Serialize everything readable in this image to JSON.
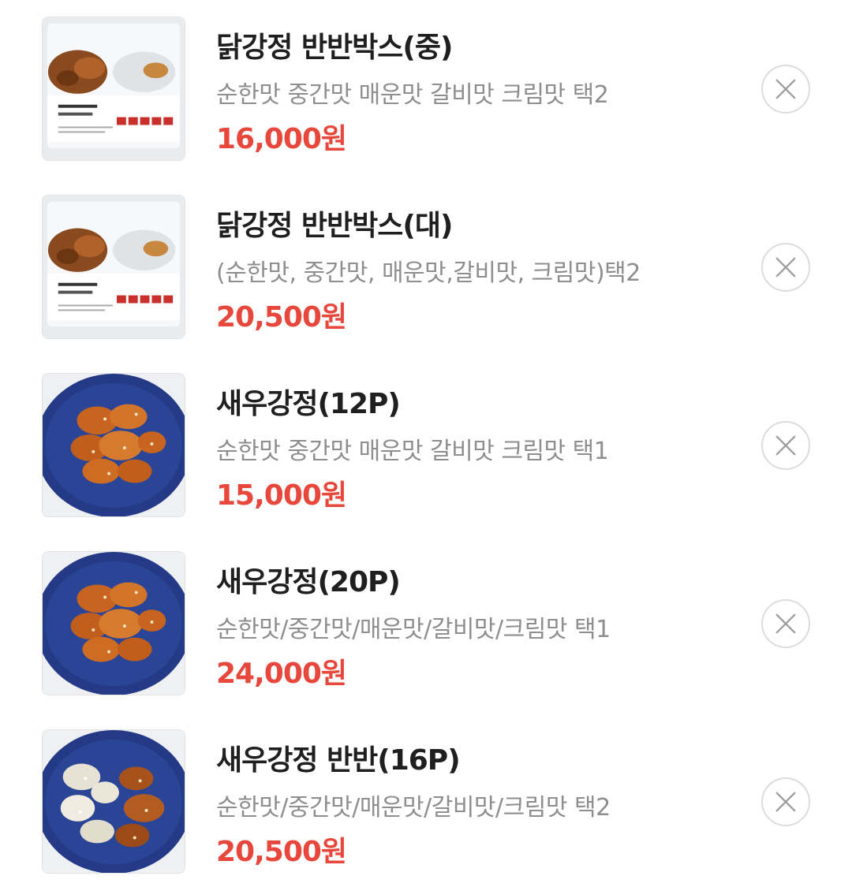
{
  "cart": {
    "items": [
      {
        "title": "닭강정 반반박스(중)",
        "options": "순한맛 중간맛 매운맛 갈비맛 크림맛 택2",
        "price": "16,000원",
        "image": "boxed-chicken-photo",
        "remove_icon": "close-icon"
      },
      {
        "title": "닭강정 반반박스(대)",
        "options": "(순한맛, 중간맛, 매운맛,갈비맛, 크림맛)택2",
        "price": "20,500원",
        "image": "boxed-chicken-photo",
        "remove_icon": "close-icon"
      },
      {
        "title": "새우강정(12P)",
        "options": "순한맛 중간맛 매운맛 갈비맛 크림맛 택1",
        "price": "15,000원",
        "image": "shrimp-plate-photo",
        "remove_icon": "close-icon"
      },
      {
        "title": "새우강정(20P)",
        "options": "순한맛/중간맛/매운맛/갈비맛/크림맛 택1",
        "price": "24,000원",
        "image": "shrimp-plate-photo",
        "remove_icon": "close-icon"
      },
      {
        "title": "새우강정 반반(16P)",
        "options": "순한맛/중간맛/매운맛/갈비맛/크림맛 택2",
        "price": "20,500원",
        "image": "shrimp-half-plate-photo",
        "remove_icon": "close-icon"
      }
    ]
  },
  "colors": {
    "price": "#e8473b",
    "title": "#1f1f1f",
    "options": "#8e8e8e",
    "remove_border": "#dcdcdc",
    "plate_blue": "#243a86"
  }
}
